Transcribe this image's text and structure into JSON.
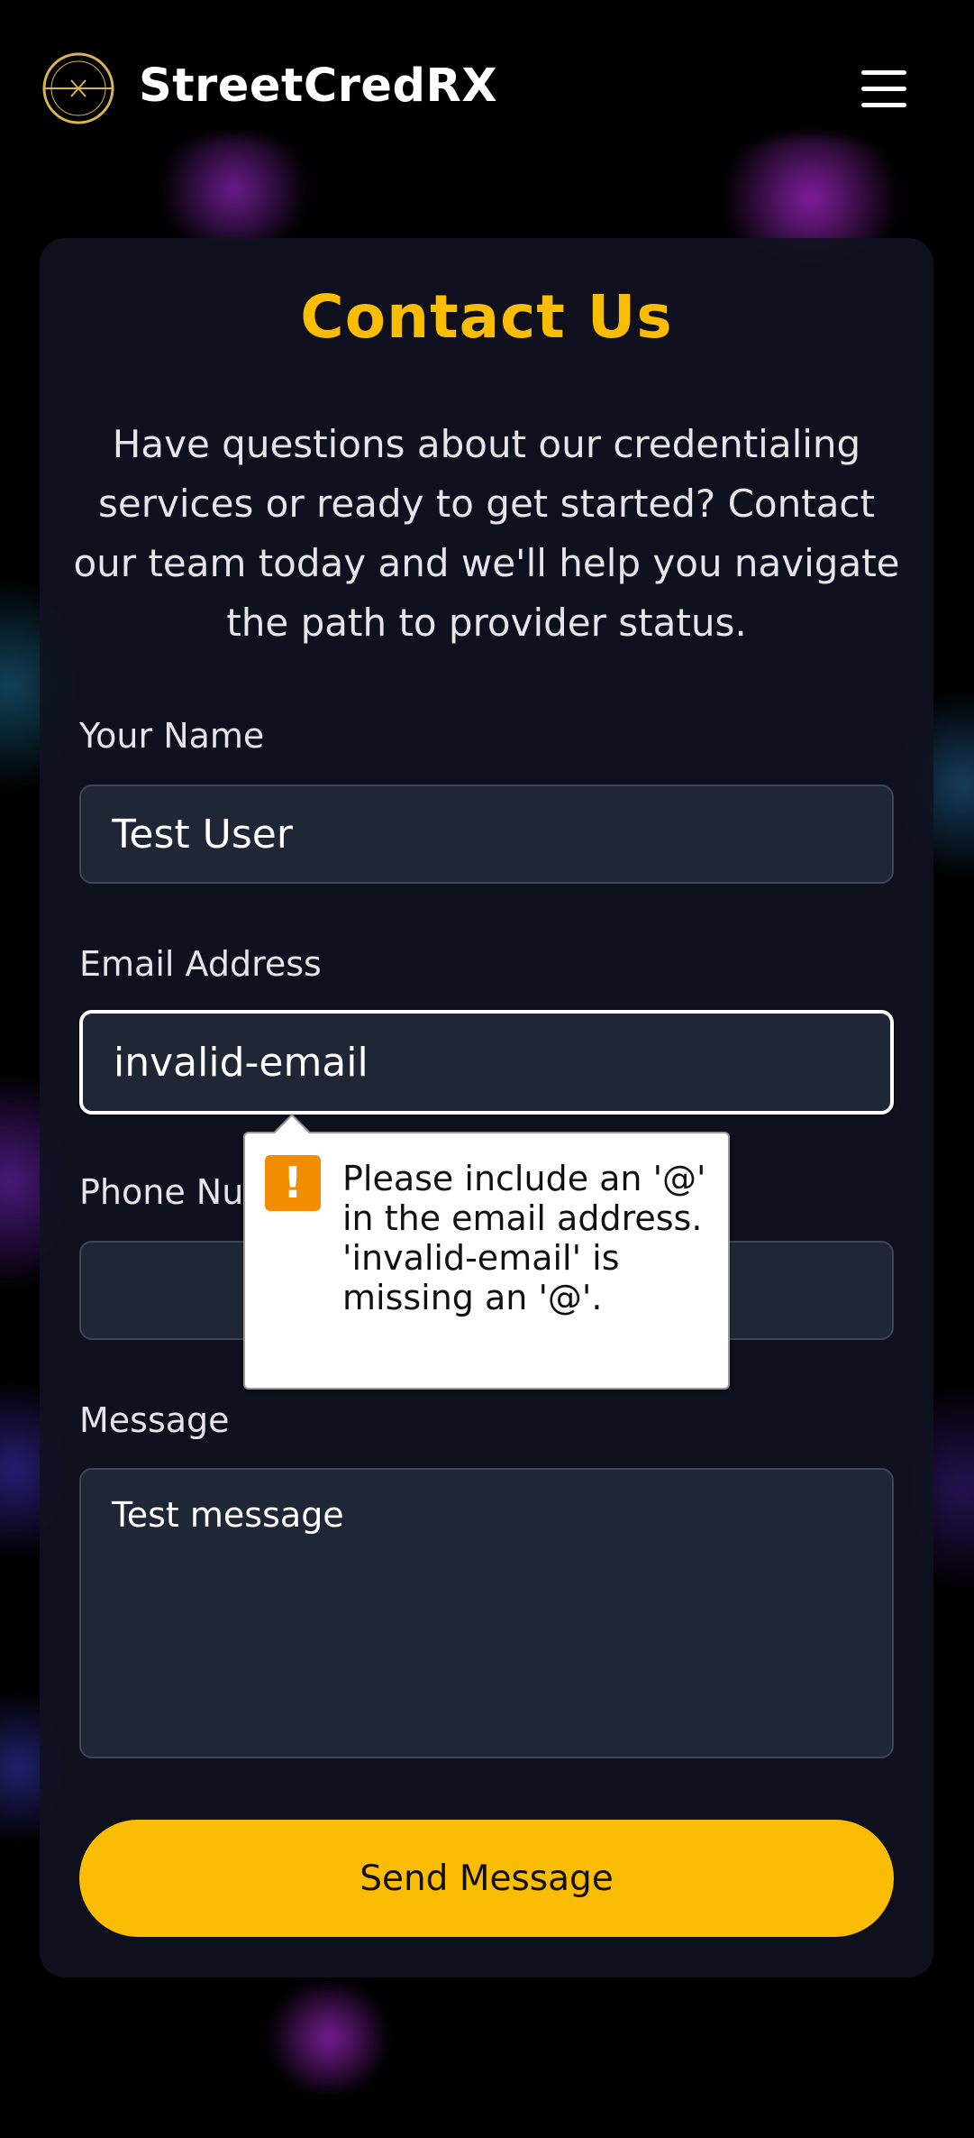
{
  "header": {
    "brand": "StreetCredRX",
    "logo_icon": "compass-logo-icon",
    "menu_icon": "hamburger-menu-icon"
  },
  "contact": {
    "title": "Contact Us",
    "intro": "Have questions about our credentialing services or ready to get started? Contact our team today and we'll help you navigate the path to provider status.",
    "name_label": "Your Name",
    "name_value": "Test User",
    "email_label": "Email Address",
    "email_value": "invalid-email",
    "phone_label": "Phone Number",
    "phone_value": "",
    "message_label": "Message",
    "message_value": "Test message",
    "submit_label": "Send Message"
  },
  "validation_tooltip": {
    "icon": "warning-icon",
    "message": "Please include an '@' in the email address. 'invalid-email' is missing an '@'."
  },
  "colors": {
    "accent": "#fbbc04",
    "background": "#000000",
    "card": "#0f1220",
    "field": "#1f2736",
    "warning": "#f28c00"
  }
}
